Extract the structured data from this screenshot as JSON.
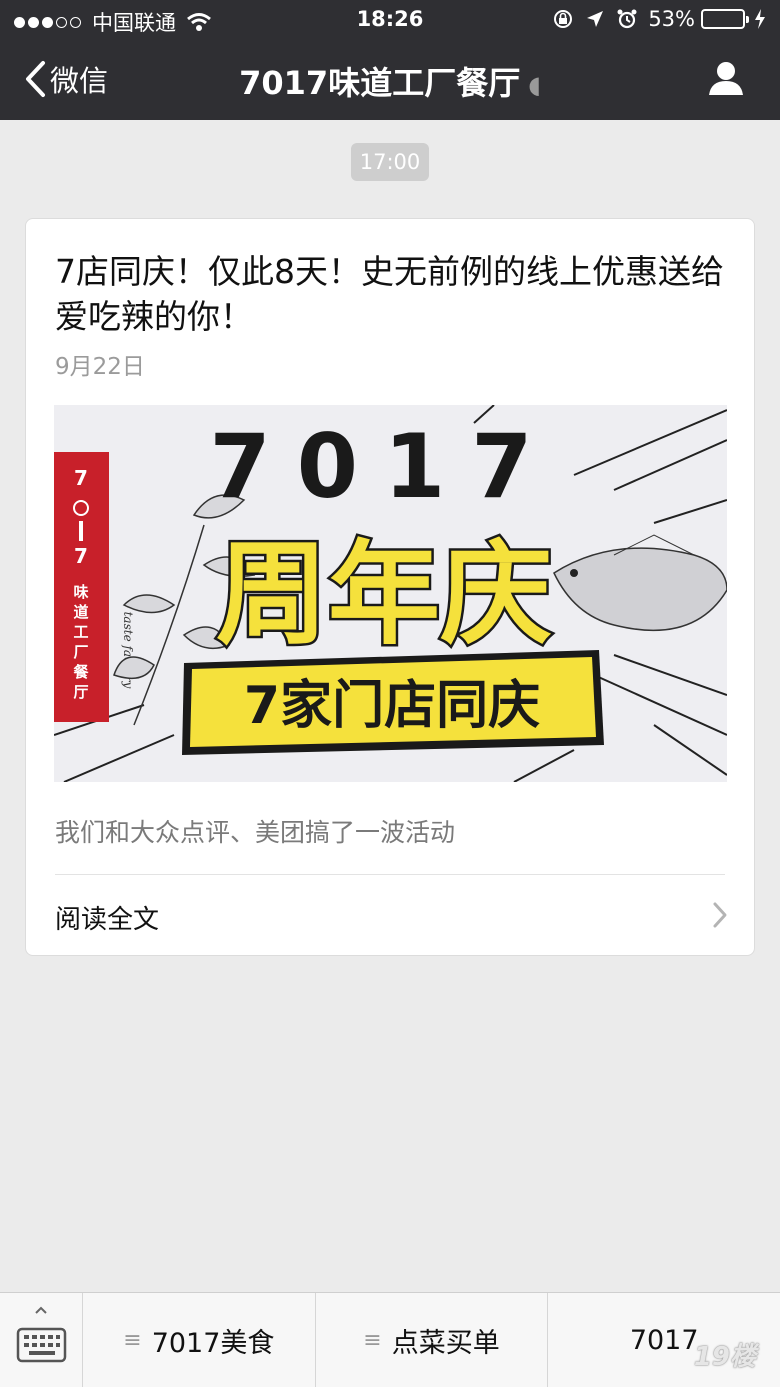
{
  "status": {
    "carrier": "中国联通",
    "time": "18:26",
    "battery": "53%",
    "battery_level": 0.53,
    "battery_color": "#4cd964"
  },
  "nav": {
    "back_label": "微信",
    "title": "7017味道工厂餐厅",
    "background": "#2f2f33"
  },
  "message": {
    "timestamp": "17:00",
    "article": {
      "title": "7店同庆！仅此8天！史无前例的线上优惠送给爱吃辣的你！",
      "date": "9月22日",
      "cover": {
        "number": "7017",
        "headline": "周年庆",
        "banner": "7家门店同庆",
        "tag_top": "7〇17",
        "tag_mid": "taste factory",
        "tag_name": "味道工厂餐厅",
        "accent_yellow": "#f5e13c",
        "accent_red": "#c8202a"
      },
      "summary": "我们和大众点评、美团搞了一波活动",
      "read_more": "阅读全文"
    }
  },
  "menu": {
    "items": [
      {
        "label": "7017美食",
        "icon": "menu-lines-icon"
      },
      {
        "label": "点菜买单",
        "icon": "menu-lines-icon"
      },
      {
        "label": "7017",
        "icon": ""
      }
    ]
  },
  "watermark": "19楼"
}
